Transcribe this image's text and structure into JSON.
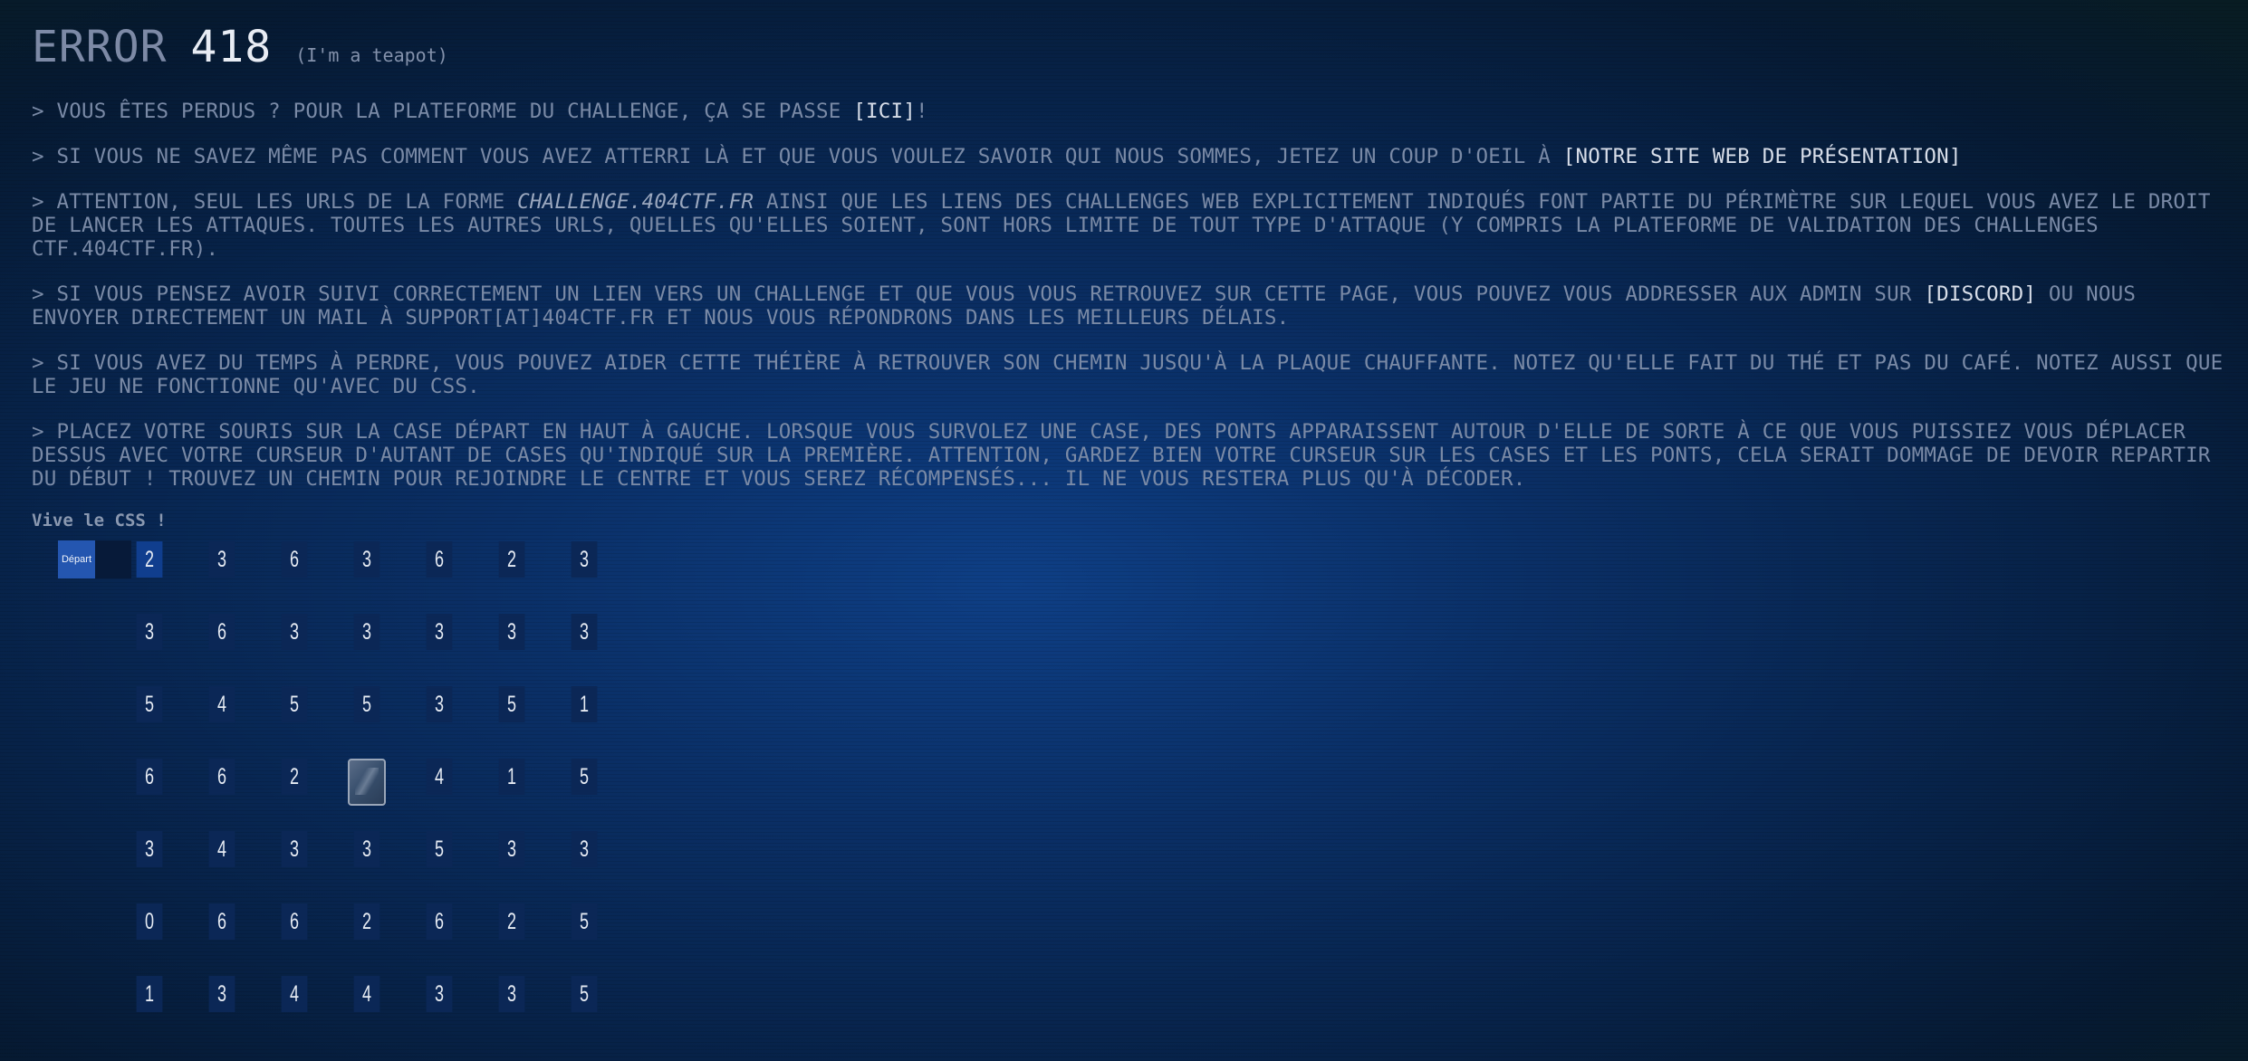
{
  "header": {
    "error_word": "ERROR",
    "error_code": "418",
    "subtitle": "(I'm a teapot)"
  },
  "paragraphs": {
    "p1": {
      "before": "> Vous êtes perdus ? Pour la plateforme du challenge, ça se passe ",
      "link": "[ICI]",
      "after": "!"
    },
    "p2": {
      "before": "> Si vous ne savez même pas comment vous avez atterri là et que vous voulez savoir qui nous sommes, jetez un coup d'oeil à ",
      "link": "[notre site web de présentation]"
    },
    "p3": {
      "before": "> Attention, seul les urls de la forme ",
      "em": "challenge.404ctf.fr",
      "after": " ainsi que les liens des challenges web explicitement indiqués font partie du périmètre sur lequel vous avez le droit de lancer les attaques. Toutes les autres urls, quelles qu'elles soient, sont hors limite de tout type d'attaque (y compris la plateforme de validation des challenges ctf.404ctf.fr)."
    },
    "p4": {
      "before": "> Si vous pensez avoir suivi correctement un lien vers un challenge et que vous vous retrouvez sur cette page, vous pouvez vous addresser aux admin sur ",
      "link": "[Discord]",
      "after": " ou nous envoyer directement un mail à support[at]404ctf.fr et nous vous répondrons dans les meilleurs délais."
    },
    "p5": "> Si vous avez du temps à perdre, vous pouvez aider cette théière à retrouver son chemin jusqu'à la plaque chauffante. Notez qu'elle fait du thé et pas du café. Notez aussi que le jeu ne fonctionne qu'avec du CSS.",
    "p6": "> Placez votre souris sur la case départ en haut à gauche. Lorsque vous survolez une case, des ponts apparaissent autour d'elle de sorte à ce que vous puissiez vous déplacer dessus avec votre curseur d'autant de cases qu'indiqué sur la première. Attention, gardez bien votre curseur sur les cases et les ponts, cela serait dommage de devoir repartir du début ! Trouvez un chemin pour rejoindre le centre et vous serez récompensés... Il ne vous restera plus qu'à décoder."
  },
  "game": {
    "label": "Vive le CSS !",
    "start_label": "Départ",
    "center_icon": "teapot-icon",
    "active_color": "#103e8e",
    "rows": [
      [
        "2",
        "3",
        "6",
        "3",
        "6",
        "2",
        "3"
      ],
      [
        "3",
        "6",
        "3",
        "3",
        "3",
        "3",
        "3"
      ],
      [
        "5",
        "4",
        "5",
        "5",
        "3",
        "5",
        "1"
      ],
      [
        "6",
        "6",
        "2",
        "",
        "4",
        "1",
        "5"
      ],
      [
        "3",
        "4",
        "3",
        "3",
        "5",
        "3",
        "3"
      ],
      [
        "0",
        "6",
        "6",
        "2",
        "6",
        "2",
        "5"
      ],
      [
        "1",
        "3",
        "4",
        "4",
        "3",
        "3",
        "5"
      ]
    ]
  }
}
